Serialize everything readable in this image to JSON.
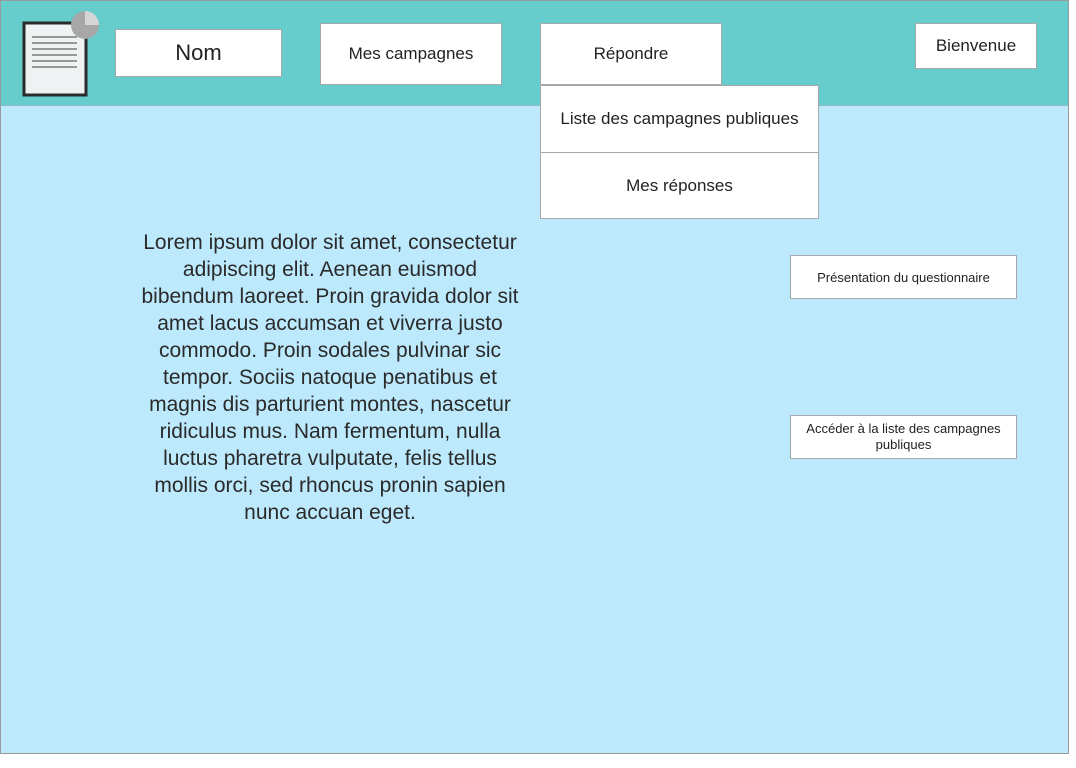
{
  "colors": {
    "header_bg": "#66cccc",
    "page_bg": "#bde9fc",
    "box_bg": "#ffffff"
  },
  "logo": {
    "icon": "document-chart-icon"
  },
  "nav": {
    "nom_label": "Nom",
    "mes_campagnes_label": "Mes campagnes",
    "repondre_label": "Répondre",
    "bienvenue_label": "Bienvenue"
  },
  "dropdown": {
    "items": [
      {
        "label": "Liste des campagnes publiques"
      },
      {
        "label": "Mes réponses"
      }
    ]
  },
  "main": {
    "lorem_text": "Lorem ipsum dolor sit amet, consectetur adipiscing elit. Aenean euismod bibendum laoreet. Proin gravida dolor sit amet lacus accumsan et viverra justo commodo. Proin sodales pulvinar sic tempor. Sociis natoque penatibus et magnis dis parturient montes, nascetur ridiculus mus. Nam fermentum, nulla luctus pharetra vulputate, felis tellus mollis orci, sed rhoncus pronin sapien nunc accuan eget."
  },
  "sidebar": {
    "presentation_label": "Présentation du questionnaire",
    "acceder_label": "Accéder à la liste des campagnes publiques"
  }
}
